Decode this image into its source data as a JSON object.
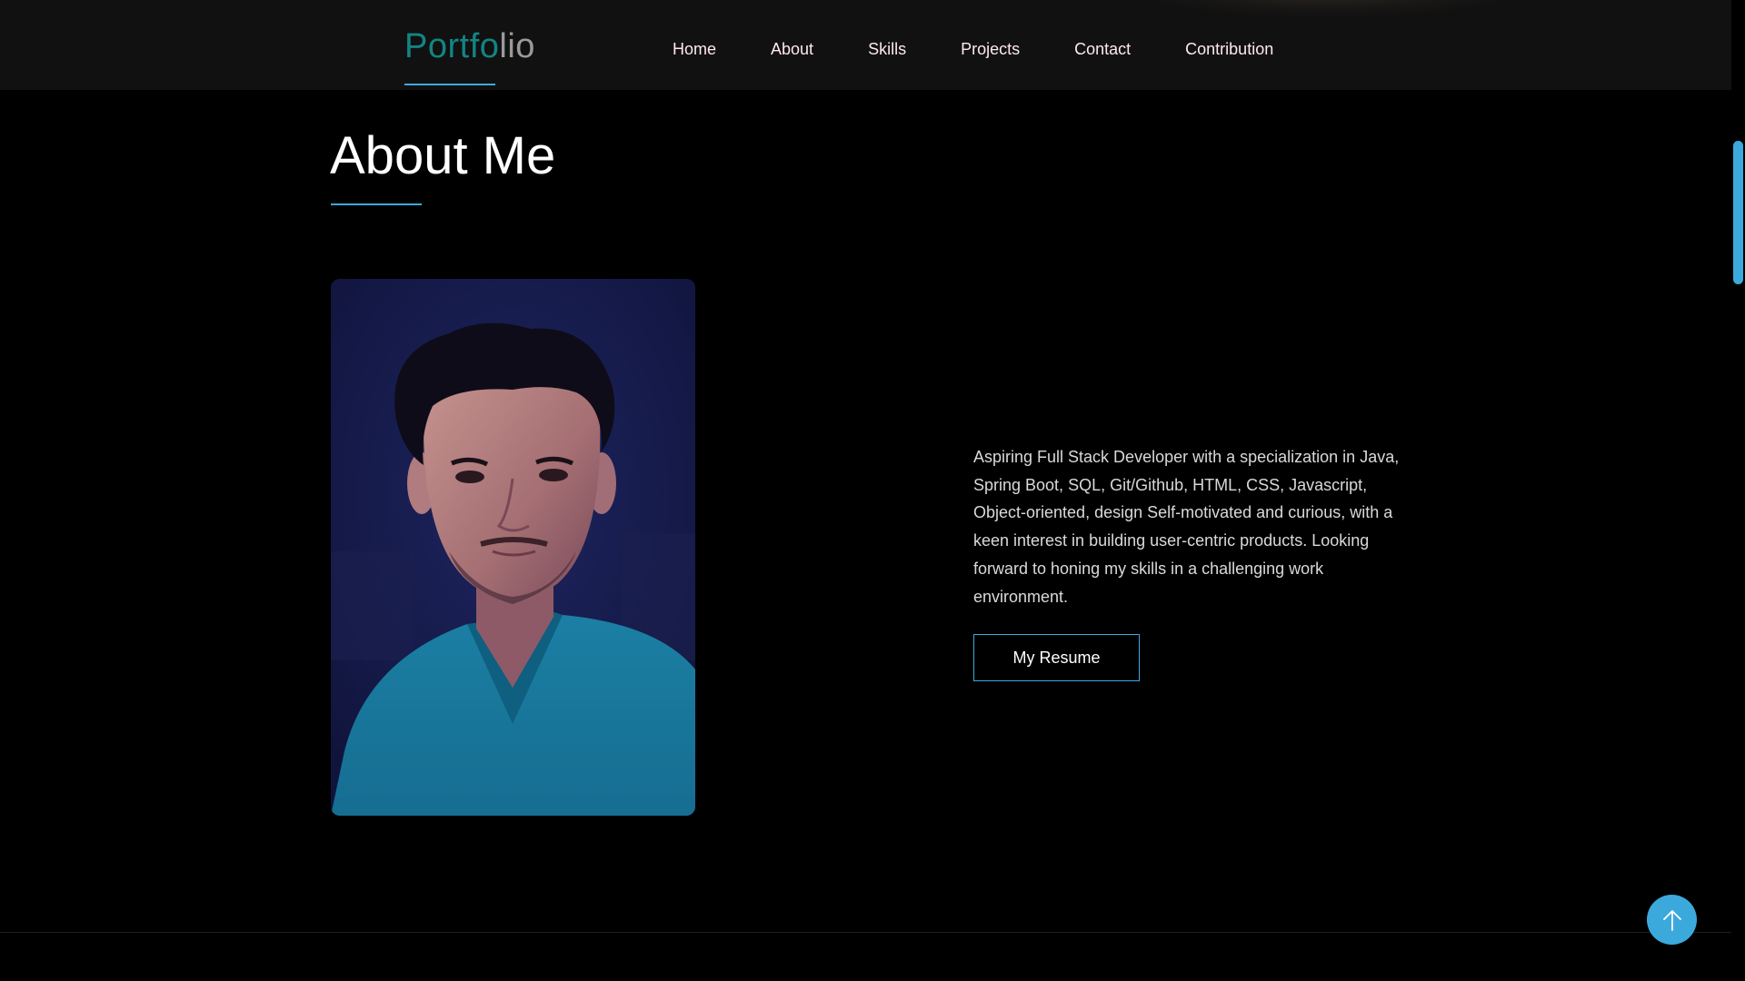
{
  "header": {
    "logo_part1": "Portfo",
    "logo_part2": "lio",
    "nav": [
      {
        "label": "Home"
      },
      {
        "label": "About"
      },
      {
        "label": "Skills"
      },
      {
        "label": "Projects"
      },
      {
        "label": "Contact"
      },
      {
        "label": "Contribution"
      }
    ]
  },
  "about": {
    "title": "About Me",
    "bio": "Aspiring Full Stack Developer with a specialization in Java, Spring Boot, SQL, Git/Github, HTML, CSS, Javascript, Object-oriented, design Self-motivated and curious, with a keen interest in building user-centric products. Looking forward to honing my skills in a challenging work environment.",
    "resume_button": "My Resume"
  },
  "icons": {
    "back_to_top": "arrow-up-icon"
  },
  "colors": {
    "background": "#000000",
    "navbar": "#111111",
    "accent": "#3ca9dd",
    "logo_teal": "#128583",
    "logo_gray": "#9a9a9a",
    "nav_text": "#ffe9ec"
  }
}
